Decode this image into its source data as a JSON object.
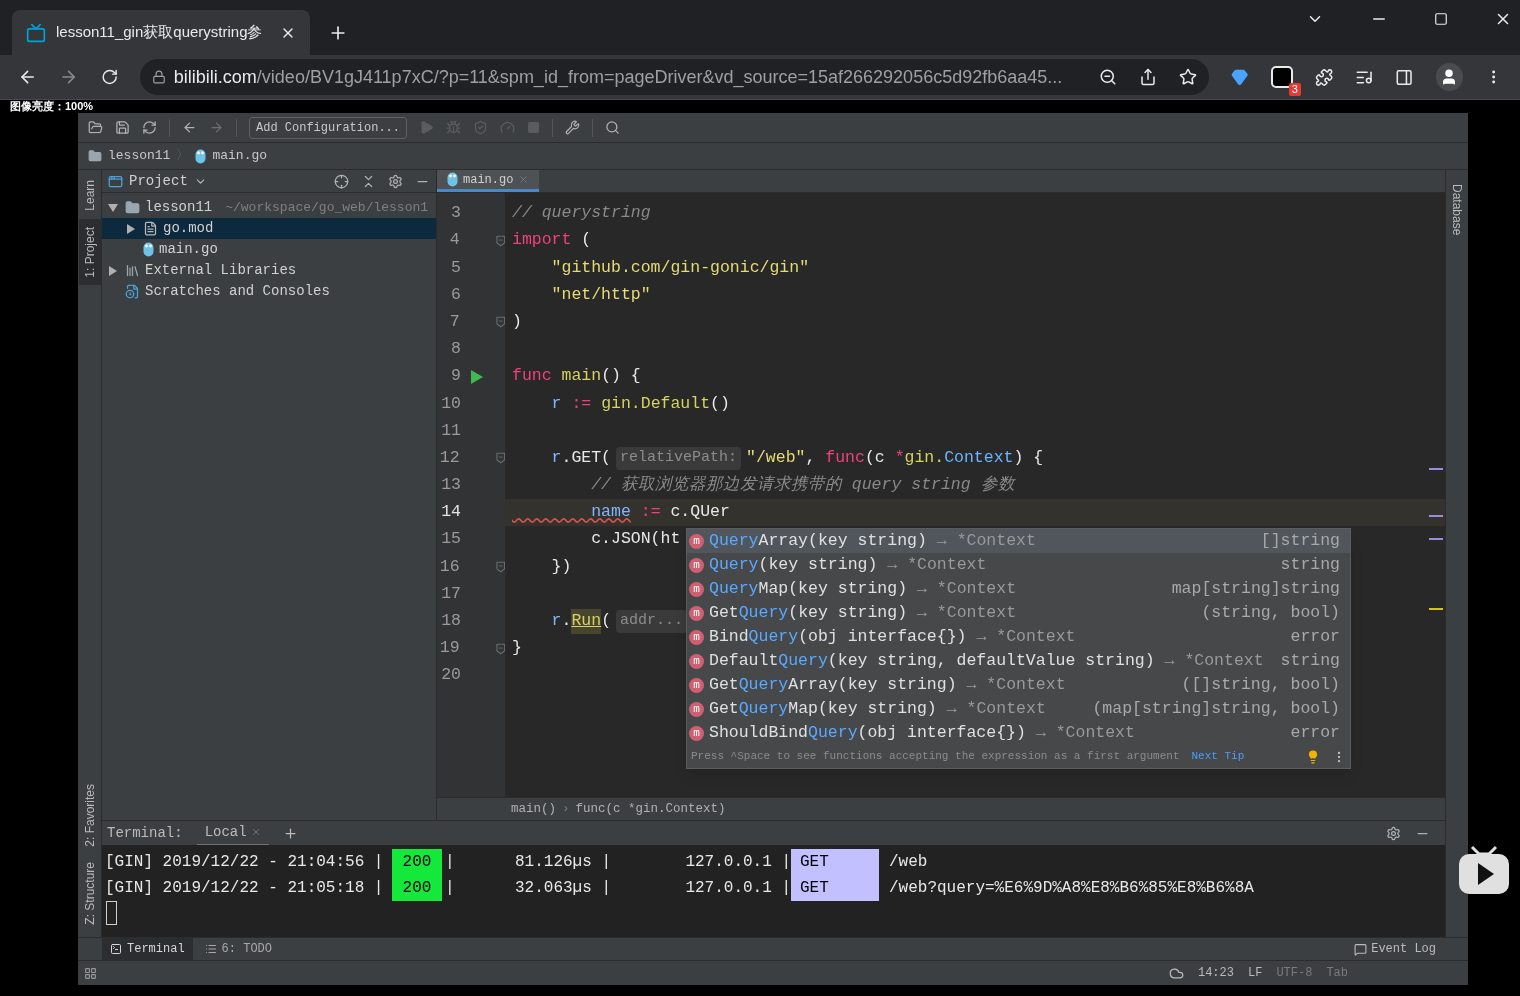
{
  "browser": {
    "tabs": [
      {
        "title": "lesson11_gin获取querystring参",
        "selected": true
      }
    ],
    "url_host": "bilibili.com",
    "url_path": "/video/BV1gJ411p7xC/?p=11&spm_id_from=pageDriver&vd_source=15af266292056c5d92fb6aa45...",
    "extension_badge": "3"
  },
  "overlay_label": "图像亮度：100%",
  "ide": {
    "toolbar": {
      "config_button": "Add Configuration..."
    },
    "nav_bar": {
      "items": [
        "lesson11",
        "main.go"
      ],
      "separator": "〉"
    },
    "left_strip_top": [
      {
        "label": "Learn",
        "selected": false
      },
      {
        "label": "1: Project",
        "selected": true
      }
    ],
    "left_strip_bottom": [
      {
        "label": "2: Favorites",
        "selected": false
      },
      {
        "label": "Z: Structure",
        "selected": false
      }
    ],
    "right_strip": [
      "Database"
    ],
    "project": {
      "title": "Project",
      "tree": [
        {
          "label": "lesson11",
          "path": "~/workspace/go_web/lesson1",
          "kind": "folder",
          "expanded": true,
          "selected": false,
          "children": [
            {
              "label": "go.mod",
              "kind": "file",
              "expanded": false,
              "selected": true
            },
            {
              "label": "main.go",
              "kind": "go",
              "selected": false
            }
          ]
        },
        {
          "label": "External Libraries",
          "kind": "library",
          "expanded": false,
          "selected": false
        },
        {
          "label": "Scratches and Consoles",
          "kind": "scratch",
          "selected": false
        }
      ]
    },
    "editor": {
      "tabs": [
        {
          "label": "main.go",
          "selected": true
        }
      ],
      "lines": [
        {
          "number": "3",
          "current": false,
          "kind": "plain",
          "tokens": [
            {
              "kind": "comment",
              "text": "// querystring"
            }
          ]
        },
        {
          "number": "4",
          "current": false,
          "kind": "fold",
          "tokens": [
            {
              "kind": "keyword",
              "text": "import"
            },
            {
              "kind": "plain",
              "text": " ("
            }
          ]
        },
        {
          "number": "5",
          "current": false,
          "kind": "plain",
          "tokens": [
            {
              "kind": "string",
              "text": "    \"github.com/gin-gonic/gin\""
            }
          ]
        },
        {
          "number": "6",
          "current": false,
          "kind": "plain",
          "tokens": [
            {
              "kind": "string",
              "text": "    \"net/http\""
            }
          ]
        },
        {
          "number": "7",
          "current": false,
          "kind": "fold",
          "tokens": [
            {
              "kind": "plain",
              "text": ")"
            }
          ]
        },
        {
          "number": "8",
          "current": false,
          "kind": "plain"
        },
        {
          "number": "9",
          "current": false,
          "kind": "run",
          "tokens": [
            {
              "kind": "keyword",
              "text": "func"
            },
            {
              "kind": "func",
              "text": " main"
            },
            {
              "kind": "plain",
              "text": "() {"
            }
          ]
        },
        {
          "number": "10",
          "current": false,
          "kind": "plain",
          "tokens": [
            {
              "kind": "var",
              "text": "    r"
            },
            {
              "kind": "op",
              "text": " :="
            },
            {
              "kind": "func",
              "text": " gin.Default"
            },
            {
              "kind": "plain",
              "text": "()"
            }
          ]
        },
        {
          "number": "11",
          "current": false,
          "kind": "plain"
        },
        {
          "number": "12",
          "current": false,
          "kind": "fold",
          "tokens": [
            {
              "kind": "var",
              "text": "    r"
            },
            {
              "kind": "plain",
              "text": ".GET("
            },
            {
              "kind": "hint",
              "text": "relativePath:"
            },
            {
              "kind": "string",
              "text": "\"/web\""
            },
            {
              "kind": "plain",
              "text": ", "
            },
            {
              "kind": "keyword",
              "text": "func"
            },
            {
              "kind": "plain",
              "text": "(c "
            },
            {
              "kind": "op",
              "text": "*"
            },
            {
              "kind": "func",
              "text": "gin."
            },
            {
              "kind": "type",
              "text": "Context"
            },
            {
              "kind": "plain",
              "text": ") {"
            }
          ]
        },
        {
          "number": "13",
          "current": false,
          "kind": "plain",
          "tokens": [
            {
              "kind": "comment",
              "text": "        // 获取浏览器那边发请求携带的 query string 参数"
            }
          ]
        },
        {
          "number": "14",
          "current": true,
          "kind": "plain",
          "tokens": [
            {
              "kind": "unused",
              "text": "        name"
            },
            {
              "kind": "op",
              "text": " :="
            },
            {
              "kind": "plain",
              "text": " c.QUer"
            }
          ]
        },
        {
          "number": "15",
          "current": false,
          "kind": "plain",
          "tokens": [
            {
              "kind": "plain",
              "text": "        c.JSON(ht"
            }
          ]
        },
        {
          "number": "16",
          "current": false,
          "kind": "fold",
          "tokens": [
            {
              "kind": "plain",
              "text": "    })"
            }
          ]
        },
        {
          "number": "17",
          "current": false,
          "kind": "plain"
        },
        {
          "number": "18",
          "current": false,
          "kind": "plain",
          "tokens": [
            {
              "kind": "var",
              "text": "    r"
            },
            {
              "kind": "plain",
              "text": "."
            },
            {
              "kind": "warn",
              "text": "Run"
            },
            {
              "kind": "plain",
              "text": "("
            },
            {
              "kind": "hint",
              "text": "addr..."
            }
          ]
        },
        {
          "number": "19",
          "current": false,
          "kind": "fold",
          "tokens": [
            {
              "kind": "plain",
              "text": "}"
            }
          ]
        },
        {
          "number": "20",
          "current": false,
          "kind": "plain"
        }
      ],
      "completion": {
        "items": [
          {
            "icon": "m",
            "match": "Query",
            "rest": "Array(key string)",
            "receiver": "→ *Context",
            "returns": "[]string",
            "selected": true
          },
          {
            "icon": "m",
            "match": "Query",
            "rest": "(key string)",
            "receiver": "→ *Context",
            "returns": "string",
            "selected": false
          },
          {
            "icon": "m",
            "match": "Query",
            "rest": "Map(key string)",
            "receiver": "→ *Context",
            "returns": "map[string]string",
            "selected": false
          },
          {
            "icon": "m",
            "prefix": "Get",
            "match": "Query",
            "rest": "(key string)",
            "receiver": "→ *Context",
            "returns": "(string, bool)",
            "selected": false
          },
          {
            "icon": "m",
            "prefix": "Bind",
            "match": "Query",
            "rest": "(obj interface{})",
            "receiver": "→ *Context",
            "returns": "error",
            "selected": false
          },
          {
            "icon": "m",
            "prefix": "Default",
            "match": "Query",
            "rest": "(key string, defaultValue string)",
            "receiver": "→ *Context",
            "returns": "string",
            "selected": false
          },
          {
            "icon": "m",
            "prefix": "Get",
            "match": "Query",
            "rest": "Array(key string)",
            "receiver": "→ *Context",
            "returns": "([]string, bool)",
            "selected": false
          },
          {
            "icon": "m",
            "prefix": "Get",
            "match": "Query",
            "rest": "Map(key string)",
            "receiver": "→ *Context",
            "returns": "(map[string]string, bool)",
            "selected": false
          },
          {
            "icon": "m",
            "prefix": "ShouldBind",
            "match": "Query",
            "rest": "(obj interface{})",
            "receiver": "→ *Context",
            "returns": "error",
            "selected": false
          }
        ],
        "footer": "Press ^Space to see functions accepting the expression as a first argument",
        "tip_link": "Next Tip"
      },
      "breadcrumb": {
        "items": [
          "main()",
          "func(c *gin.Context)"
        ],
        "separator": "›"
      }
    },
    "terminal": {
      "title": "Terminal:",
      "tabs": [
        {
          "label": "Local",
          "selected": true
        }
      ],
      "rows": [
        {
          "prefix": "[GIN] 2019/12/22 - 21:04:56 |",
          "status": "200",
          "sep": "|",
          "latency": "81.126µs |",
          "ip": "127.0.0.1 |",
          "method": "GET",
          "path": "/web"
        },
        {
          "prefix": "[GIN] 2019/12/22 - 21:05:18 |",
          "status": "200",
          "sep": "|",
          "latency": "32.063µs |",
          "ip": "127.0.0.1 |",
          "method": "GET",
          "path": "/web?query=%E6%9D%A8%E8%B6%85%E8%B6%8A"
        }
      ]
    },
    "tool_tabs": [
      {
        "label": "Terminal",
        "selected": true
      },
      {
        "label": "6: TODO",
        "selected": false
      }
    ],
    "event_log": "Event Log",
    "status_bar": [
      "14:23",
      "LF",
      "UTF-8",
      "Tab"
    ]
  }
}
